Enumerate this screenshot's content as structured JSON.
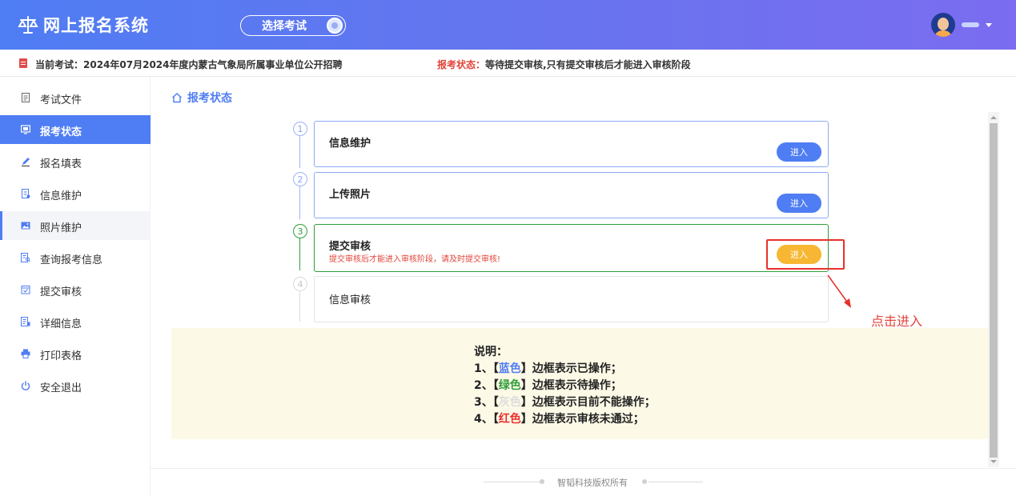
{
  "header": {
    "app_title": "网上报名系统",
    "logo_icon": "scales-icon",
    "select_exam_label": "选择考试"
  },
  "infobar": {
    "current_exam": "当前考试：2024年07月2024年度内蒙古气象局所属事业单位公开招聘",
    "status_label": "报考状态：",
    "status_value": "等待提交审核,只有提交审核后才能进入审核阶段"
  },
  "sidebar": {
    "items": [
      {
        "label": "考试文件",
        "icon": "document-icon"
      },
      {
        "label": "报考状态",
        "icon": "monitor-icon",
        "active": true
      },
      {
        "label": "报名填表",
        "icon": "pencil-icon"
      },
      {
        "label": "信息维护",
        "icon": "form-icon"
      },
      {
        "label": "照片维护",
        "icon": "image-icon",
        "hover": true
      },
      {
        "label": "查询报考信息",
        "icon": "search-doc-icon"
      },
      {
        "label": "提交审核",
        "icon": "calendar-check-icon"
      },
      {
        "label": "详细信息",
        "icon": "detail-icon"
      },
      {
        "label": "打印表格",
        "icon": "printer-icon"
      },
      {
        "label": "安全退出",
        "icon": "power-icon"
      }
    ]
  },
  "main": {
    "heading": "报考状态",
    "steps": [
      {
        "num": "1",
        "title": "信息维护",
        "button": "进入",
        "state": "blue"
      },
      {
        "num": "2",
        "title": "上传照片",
        "button": "进入",
        "state": "blue"
      },
      {
        "num": "3",
        "title": "提交审核",
        "subtitle": "提交审核后才能进入审核阶段，请及时提交审核!",
        "button": "进入",
        "state": "green"
      },
      {
        "num": "4",
        "title": "信息审核",
        "state": "gray"
      }
    ],
    "click_hint": "点击进入"
  },
  "explanation": {
    "title": "说明：",
    "line1_prefix": "1、【",
    "line1_color": "蓝色",
    "line1_suffix": "】边框表示已操作；",
    "line2_prefix": "2、【",
    "line2_color": "绿色",
    "line2_suffix": "】边框表示待操作；",
    "line3_prefix": "3、【",
    "line3_color": "灰色",
    "line3_suffix": "】边框表示目前不能操作；",
    "line4_prefix": "4、【",
    "line4_color": "红色",
    "line4_suffix": "】边框表示审核未通过；"
  },
  "footer": {
    "copyright": "智韬科技版权所有"
  },
  "colors": {
    "primary": "#4f7df3",
    "success": "#2f9e3a",
    "warning": "#f7b733",
    "danger": "#e8302b",
    "muted": "#dcdcdc"
  }
}
